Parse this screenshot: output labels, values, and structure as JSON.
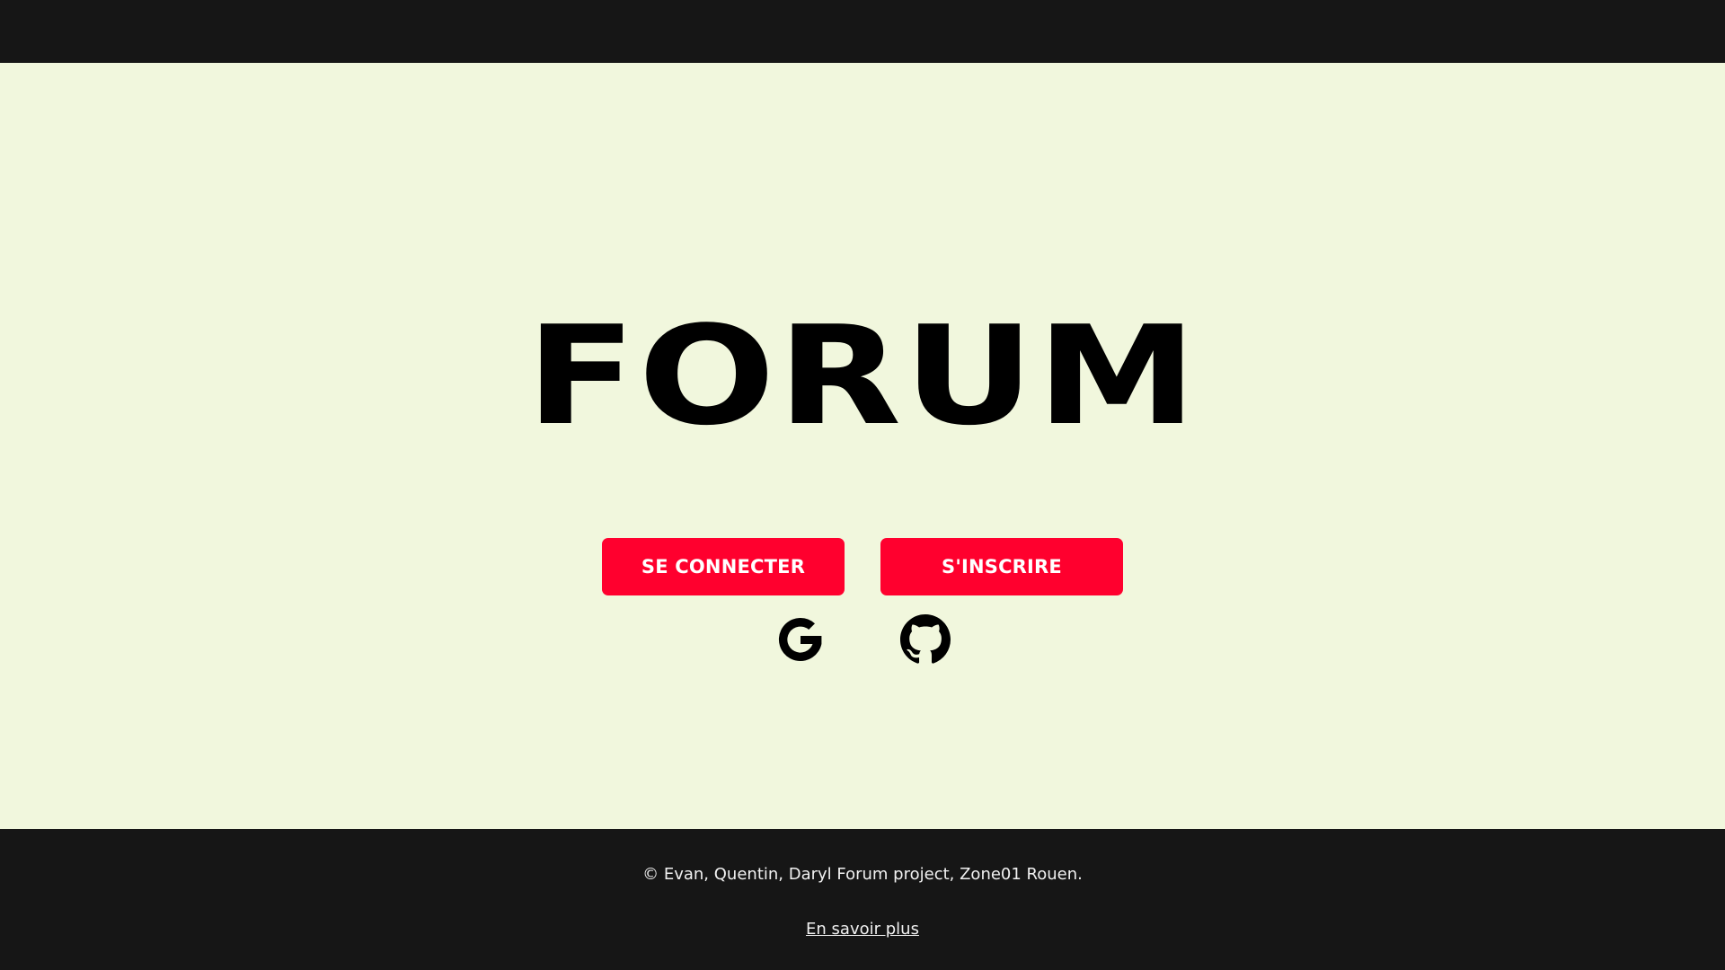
{
  "colors": {
    "background": "#f1f7dd",
    "bar": "#161616",
    "accent": "#ff002e",
    "text_dark": "#000000",
    "text_light": "#f1f1f1"
  },
  "hero": {
    "title": "FORUM"
  },
  "actions": {
    "login_label": "SE CONNECTER",
    "register_label": "S'INSCRIRE"
  },
  "oauth": {
    "google_icon": "google-icon",
    "github_icon": "github-icon"
  },
  "footer": {
    "copyright": "© Evan, Quentin, Daryl Forum project, Zone01 Rouen.",
    "learn_more": "En savoir plus"
  }
}
